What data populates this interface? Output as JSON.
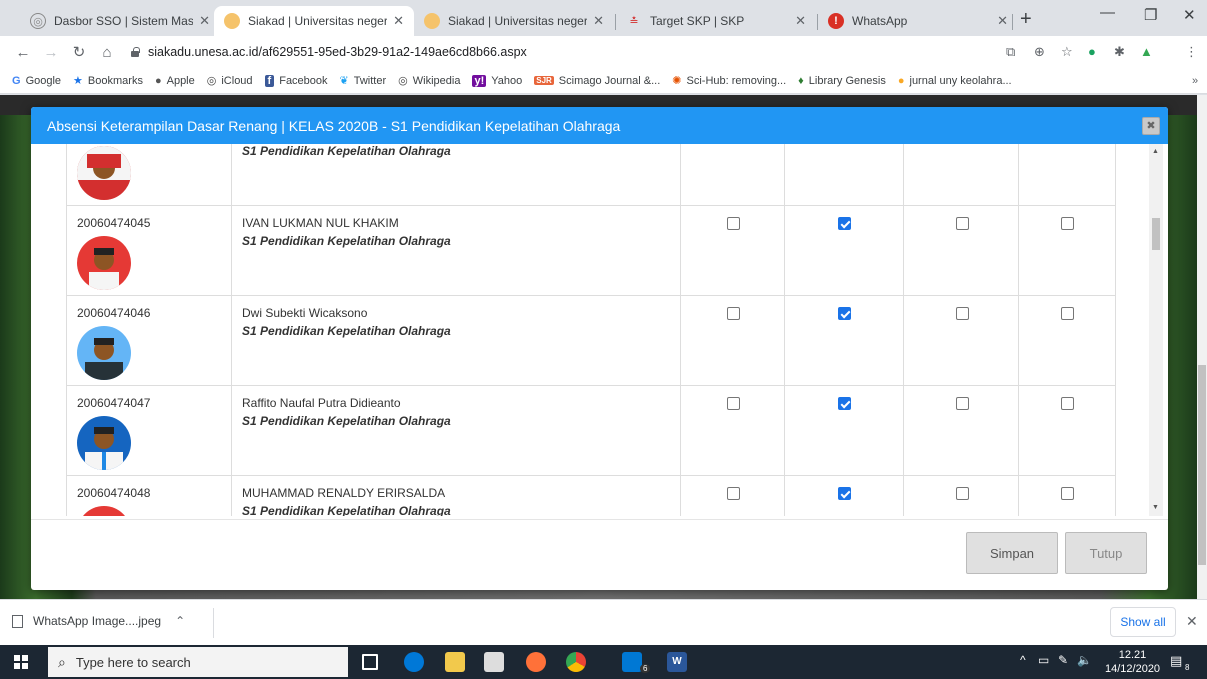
{
  "browser": {
    "tabs": [
      {
        "title": "Dasbor SSO | Sistem Masuk Tu",
        "active": false
      },
      {
        "title": "Siakad | Universitas negeri Sura",
        "active": true
      },
      {
        "title": "Siakad | Universitas negeri Sura",
        "active": false
      },
      {
        "title": "Target SKP | SKP",
        "active": false
      },
      {
        "title": "WhatsApp",
        "active": false
      }
    ],
    "url": "siakadu.unesa.ac.id/af629551-95ed-3b29-91a2-149ae6cd8b66.aspx",
    "bookmarks": [
      {
        "label": "Google",
        "icon": "google-icon"
      },
      {
        "label": "Bookmarks",
        "icon": "star-icon"
      },
      {
        "label": "Apple",
        "icon": "apple-icon"
      },
      {
        "label": "iCloud",
        "icon": "globe-icon"
      },
      {
        "label": "Facebook",
        "icon": "facebook-icon"
      },
      {
        "label": "Twitter",
        "icon": "twitter-icon"
      },
      {
        "label": "Wikipedia",
        "icon": "globe-icon"
      },
      {
        "label": "Yahoo",
        "icon": "yahoo-icon"
      },
      {
        "label": "Scimago Journal &...",
        "icon": "scimago-icon"
      },
      {
        "label": "Sci-Hub: removing...",
        "icon": "scihub-icon"
      },
      {
        "label": "Library Genesis",
        "icon": "library-icon"
      },
      {
        "label": "jurnal uny keolahra...",
        "icon": "uny-icon"
      }
    ],
    "bookmarks_overflow": "»"
  },
  "modal": {
    "title": "Absensi Keterampilan Dasar Renang | KELAS 2020B - S1 Pendidikan Kepelatihan Olahraga",
    "close_label": "✖",
    "rows": [
      {
        "nim": "",
        "name": "",
        "prodi": "S1 Pendidikan Kepelatihan Olahraga",
        "checks": [
          false,
          false,
          false,
          false
        ],
        "show_checks": false,
        "avatar_bg": "#d32f2f"
      },
      {
        "nim": "20060474045",
        "name": "IVAN LUKMAN NUL KHAKIM",
        "prodi": "S1 Pendidikan Kepelatihan Olahraga",
        "checks": [
          false,
          true,
          false,
          false
        ],
        "show_checks": true,
        "avatar_bg": "#e53935"
      },
      {
        "nim": "20060474046",
        "name": "Dwi Subekti Wicaksono",
        "prodi": "S1 Pendidikan Kepelatihan Olahraga",
        "checks": [
          false,
          true,
          false,
          false
        ],
        "show_checks": true,
        "avatar_bg": "#64b5f6"
      },
      {
        "nim": "20060474047",
        "name": "Raffito Naufal Putra Didieanto",
        "prodi": "S1 Pendidikan Kepelatihan Olahraga",
        "checks": [
          false,
          true,
          false,
          false
        ],
        "show_checks": true,
        "avatar_bg": "#1565c0"
      },
      {
        "nim": "20060474048",
        "name": "MUHAMMAD RENALDY ERIRSALDA",
        "prodi": "S1 Pendidikan Kepelatihan Olahraga",
        "checks": [
          false,
          true,
          false,
          false
        ],
        "show_checks": true,
        "avatar_bg": "#e53935"
      }
    ],
    "save_label": "Simpan",
    "close_button_label": "Tutup"
  },
  "downloads": {
    "file": "WhatsApp Image....jpeg",
    "show_all": "Show all"
  },
  "taskbar": {
    "search_placeholder": "Type here to search",
    "time": "12.21",
    "date": "14/12/2020",
    "notification_count": "8",
    "mail_badge": "6"
  },
  "colors": {
    "modal_header": "#2196f3",
    "checkbox_checked": "#1a73e8"
  }
}
